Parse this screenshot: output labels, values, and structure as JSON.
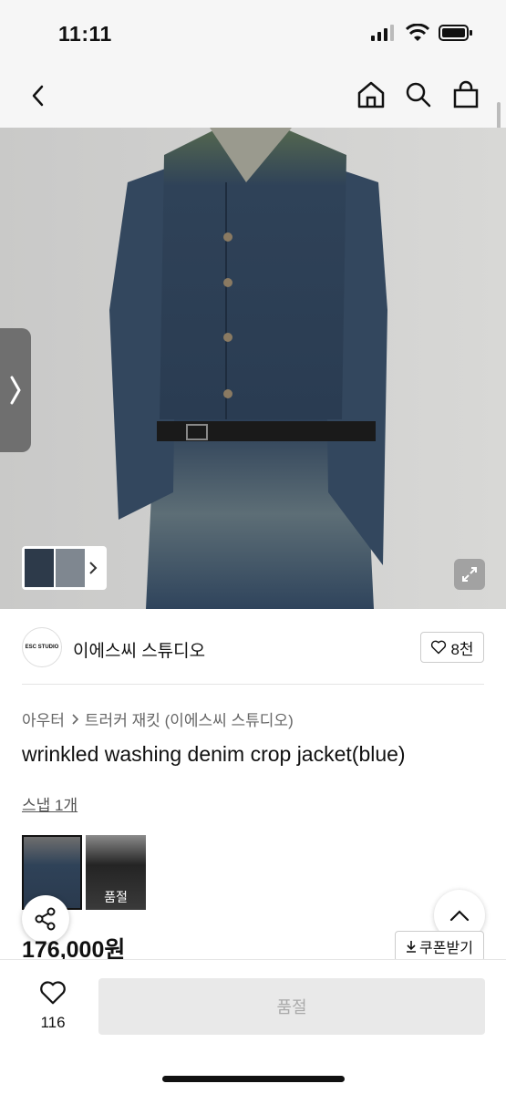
{
  "status_bar": {
    "time": "11:11"
  },
  "store": {
    "logo_text": "ESC STUDIO",
    "name": "이에스씨 스튜디오",
    "likes": "8천"
  },
  "breadcrumb": {
    "category": "아우터",
    "subcategory": "트러커 재킷 (이에스씨 스튜디오)"
  },
  "product": {
    "name": "wrinkled washing denim crop jacket(blue)",
    "snap_link": "스냅 1개",
    "price": "176,000원",
    "color_options": [
      {
        "label": "",
        "selected": true
      },
      {
        "label": "품절",
        "selected": false
      }
    ]
  },
  "actions": {
    "coupon": "쿠폰받기"
  },
  "bottom_bar": {
    "wish_count": "116",
    "buy_label": "품절"
  },
  "colors": {
    "background": "#ffffff",
    "nav_bg": "#f6f6f6",
    "denim": "#2f4258",
    "disabled_btn": "#e9e9e9"
  },
  "icons": [
    "back-icon",
    "home-icon",
    "search-icon",
    "bag-icon",
    "chevron-right-icon",
    "expand-icon",
    "heart-icon",
    "share-icon",
    "chevron-up-icon",
    "download-icon"
  ]
}
